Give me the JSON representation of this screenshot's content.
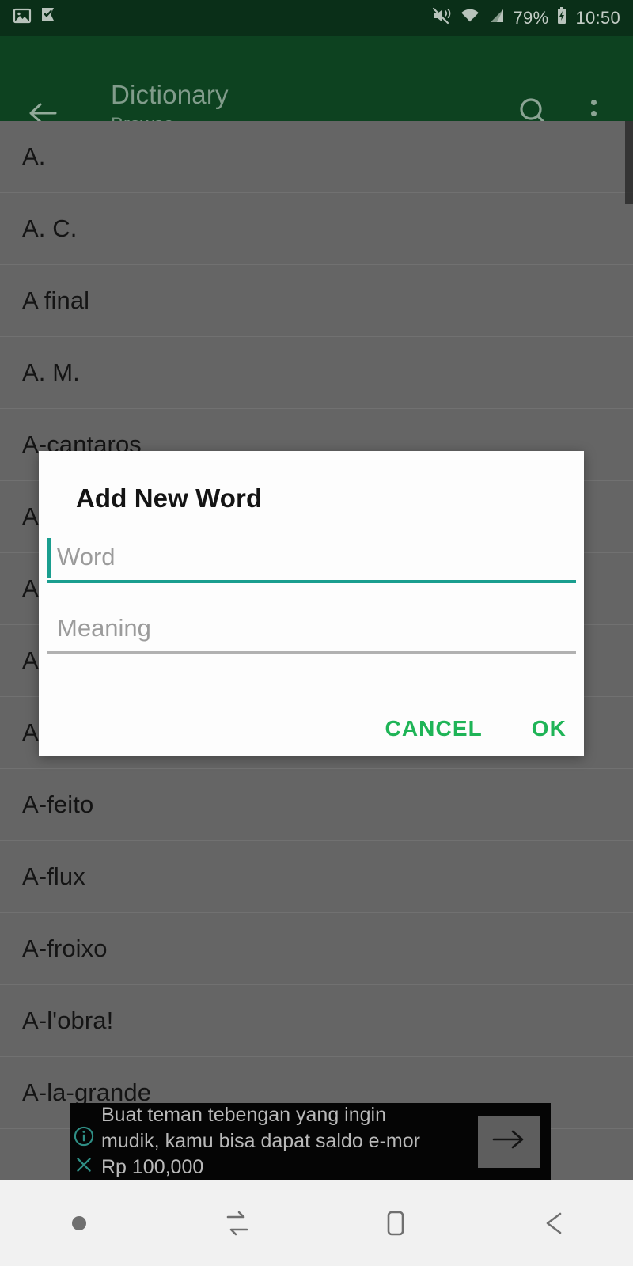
{
  "status_bar": {
    "left_icons": [
      "image-icon",
      "flag-check-icon"
    ],
    "right_icons": [
      "vibrate-mute-icon",
      "wifi-icon",
      "signal-icon",
      "battery-charging-icon"
    ],
    "battery_percent": "79%",
    "time": "10:50"
  },
  "app_bar": {
    "back_icon": "back-arrow-icon",
    "title": "Dictionary",
    "subtitle": "Browse",
    "search_icon": "search-icon",
    "overflow_icon": "more-vertical-icon"
  },
  "word_list": {
    "items": [
      {
        "label": "A."
      },
      {
        "label": "A. C."
      },
      {
        "label": "A final"
      },
      {
        "label": "A. M."
      },
      {
        "label": "A-cantaros"
      },
      {
        "label": "A"
      },
      {
        "label": "A"
      },
      {
        "label": "A"
      },
      {
        "label": "A"
      },
      {
        "label": "A-feito"
      },
      {
        "label": "A-flux"
      },
      {
        "label": "A-froixo"
      },
      {
        "label": "A-l'obra!"
      },
      {
        "label": "A-la-grande"
      }
    ]
  },
  "dialog": {
    "title": "Add New Word",
    "word_field": {
      "placeholder": "Word",
      "value": ""
    },
    "meaning_field": {
      "placeholder": "Meaning",
      "value": ""
    },
    "cancel_label": "CANCEL",
    "ok_label": "OK"
  },
  "ad_banner": {
    "info_icon": "info-circle-icon",
    "close_icon": "close-x-icon",
    "line1": "Buat teman tebengan yang ingin",
    "line2": "mudik, kamu bisa dapat saldo e-mor",
    "line3": "Rp 100,000",
    "cta_icon": "arrow-right-icon"
  },
  "nav_bar": {
    "buttons": [
      {
        "icon": "dot-indicator-icon"
      },
      {
        "icon": "recents-icon"
      },
      {
        "icon": "home-icon"
      },
      {
        "icon": "back-icon"
      }
    ]
  },
  "colors": {
    "status_bar": "#0a2f18",
    "app_bar": "#0d4220",
    "list_dim": "#656565",
    "accent_teal": "#1a9e8f",
    "accent_green": "#1fb457",
    "dialog_bg": "#fdfdfd",
    "nav_bar": "#f1f1f1"
  }
}
